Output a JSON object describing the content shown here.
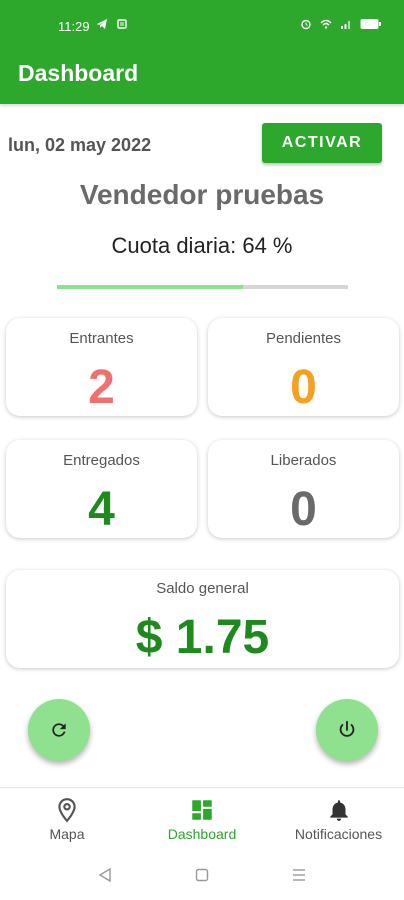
{
  "status": {
    "time": "11:29"
  },
  "appbar": {
    "title": "Dashboard"
  },
  "header": {
    "date": "lun, 02 may 2022",
    "activate_label": "ACTIVAR"
  },
  "seller": {
    "name": "Vendedor pruebas",
    "quota_text": "Cuota diaria: 64 %",
    "quota_progress": 0.64
  },
  "cards": {
    "entrantes": {
      "label": "Entrantes",
      "value": "2",
      "color": "#f07070"
    },
    "pendientes": {
      "label": "Pendientes",
      "value": "0",
      "color": "#f5a020"
    },
    "entregados": {
      "label": "Entregados",
      "value": "4",
      "color": "#1e8a1e"
    },
    "liberados": {
      "label": "Liberados",
      "value": "0",
      "color": "#6a6a6a"
    }
  },
  "balance": {
    "label": "Saldo general",
    "value": "$ 1.75",
    "color": "#1e8a1e"
  },
  "fabs": {
    "left_icon": "refresh-icon",
    "right_icon": "power-icon"
  },
  "bottom_nav": {
    "items": [
      {
        "label": "Mapa",
        "icon": "map-pin-icon"
      },
      {
        "label": "Dashboard",
        "icon": "dashboard-icon",
        "active": true
      },
      {
        "label": "Notificaciones",
        "icon": "bell-icon"
      }
    ]
  },
  "colors": {
    "brand": "#2da82d",
    "fab": "#8fe08f"
  }
}
